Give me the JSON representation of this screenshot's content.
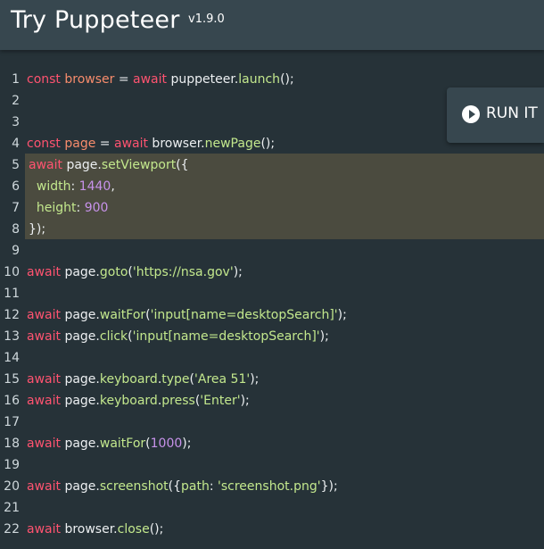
{
  "header": {
    "title": "Try Puppeteer",
    "version": "v1.9.0"
  },
  "run_button": {
    "label": "RUN IT",
    "icon": "play-circle-icon"
  },
  "colors": {
    "background": "#263238",
    "header": "#37474f",
    "keyword": "#ff5370",
    "variable": "#f78c6c",
    "function": "#c3e88d",
    "number": "#c792ea",
    "highlight": "#4b4b3f"
  },
  "editor": {
    "highlighted_lines": [
      5,
      6,
      7,
      8
    ],
    "lines": [
      {
        "n": "1",
        "tokens": [
          {
            "t": "const ",
            "c": "kw"
          },
          {
            "t": "browser",
            "c": "var"
          },
          {
            "t": " = ",
            "c": "plain"
          },
          {
            "t": "await",
            "c": "kw"
          },
          {
            "t": " puppeteer.",
            "c": "plain"
          },
          {
            "t": "launch",
            "c": "fn"
          },
          {
            "t": "();",
            "c": "plain"
          }
        ]
      },
      {
        "n": "2",
        "tokens": []
      },
      {
        "n": "3",
        "tokens": []
      },
      {
        "n": "4",
        "tokens": [
          {
            "t": "const ",
            "c": "kw"
          },
          {
            "t": "page",
            "c": "var"
          },
          {
            "t": " = ",
            "c": "plain"
          },
          {
            "t": "await",
            "c": "kw"
          },
          {
            "t": " browser.",
            "c": "plain"
          },
          {
            "t": "newPage",
            "c": "fn"
          },
          {
            "t": "();",
            "c": "plain"
          }
        ]
      },
      {
        "n": "5",
        "tokens": [
          {
            "t": "await",
            "c": "kw"
          },
          {
            "t": " page.",
            "c": "plain"
          },
          {
            "t": "setViewport",
            "c": "fn"
          },
          {
            "t": "({",
            "c": "plain"
          }
        ]
      },
      {
        "n": "6",
        "tokens": [
          {
            "t": "  ",
            "c": "plain"
          },
          {
            "t": "width",
            "c": "prop"
          },
          {
            "t": ": ",
            "c": "plain"
          },
          {
            "t": "1440",
            "c": "num"
          },
          {
            "t": ",",
            "c": "plain"
          }
        ]
      },
      {
        "n": "7",
        "tokens": [
          {
            "t": "  ",
            "c": "plain"
          },
          {
            "t": "height",
            "c": "prop"
          },
          {
            "t": ": ",
            "c": "plain"
          },
          {
            "t": "900",
            "c": "num"
          }
        ]
      },
      {
        "n": "8",
        "tokens": [
          {
            "t": "});",
            "c": "plain"
          }
        ]
      },
      {
        "n": "9",
        "tokens": []
      },
      {
        "n": "10",
        "tokens": [
          {
            "t": "await",
            "c": "kw"
          },
          {
            "t": " page.",
            "c": "plain"
          },
          {
            "t": "goto",
            "c": "fn"
          },
          {
            "t": "(",
            "c": "plain"
          },
          {
            "t": "'https://nsa.gov'",
            "c": "str"
          },
          {
            "t": ");",
            "c": "plain"
          }
        ]
      },
      {
        "n": "11",
        "tokens": []
      },
      {
        "n": "12",
        "tokens": [
          {
            "t": "await",
            "c": "kw"
          },
          {
            "t": " page.",
            "c": "plain"
          },
          {
            "t": "waitFor",
            "c": "fn"
          },
          {
            "t": "(",
            "c": "plain"
          },
          {
            "t": "'input[name=desktopSearch]'",
            "c": "str"
          },
          {
            "t": ");",
            "c": "plain"
          }
        ]
      },
      {
        "n": "13",
        "tokens": [
          {
            "t": "await",
            "c": "kw"
          },
          {
            "t": " page.",
            "c": "plain"
          },
          {
            "t": "click",
            "c": "fn"
          },
          {
            "t": "(",
            "c": "plain"
          },
          {
            "t": "'input[name=desktopSearch]'",
            "c": "str"
          },
          {
            "t": ");",
            "c": "plain"
          }
        ]
      },
      {
        "n": "14",
        "tokens": []
      },
      {
        "n": "15",
        "tokens": [
          {
            "t": "await",
            "c": "kw"
          },
          {
            "t": " page.",
            "c": "plain"
          },
          {
            "t": "keyboard",
            "c": "fn"
          },
          {
            "t": ".",
            "c": "plain"
          },
          {
            "t": "type",
            "c": "fn"
          },
          {
            "t": "(",
            "c": "plain"
          },
          {
            "t": "'Area 51'",
            "c": "str"
          },
          {
            "t": ");",
            "c": "plain"
          }
        ]
      },
      {
        "n": "16",
        "tokens": [
          {
            "t": "await",
            "c": "kw"
          },
          {
            "t": " page.",
            "c": "plain"
          },
          {
            "t": "keyboard",
            "c": "fn"
          },
          {
            "t": ".",
            "c": "plain"
          },
          {
            "t": "press",
            "c": "fn"
          },
          {
            "t": "(",
            "c": "plain"
          },
          {
            "t": "'Enter'",
            "c": "str"
          },
          {
            "t": ");",
            "c": "plain"
          }
        ]
      },
      {
        "n": "17",
        "tokens": []
      },
      {
        "n": "18",
        "tokens": [
          {
            "t": "await",
            "c": "kw"
          },
          {
            "t": " page.",
            "c": "plain"
          },
          {
            "t": "waitFor",
            "c": "fn"
          },
          {
            "t": "(",
            "c": "plain"
          },
          {
            "t": "1000",
            "c": "num"
          },
          {
            "t": ");",
            "c": "plain"
          }
        ]
      },
      {
        "n": "19",
        "tokens": []
      },
      {
        "n": "20",
        "tokens": [
          {
            "t": "await",
            "c": "kw"
          },
          {
            "t": " page.",
            "c": "plain"
          },
          {
            "t": "screenshot",
            "c": "fn"
          },
          {
            "t": "({",
            "c": "plain"
          },
          {
            "t": "path",
            "c": "prop"
          },
          {
            "t": ": ",
            "c": "plain"
          },
          {
            "t": "'screenshot.png'",
            "c": "str"
          },
          {
            "t": "});",
            "c": "plain"
          }
        ]
      },
      {
        "n": "21",
        "tokens": []
      },
      {
        "n": "22",
        "tokens": [
          {
            "t": "await",
            "c": "kw"
          },
          {
            "t": " browser.",
            "c": "plain"
          },
          {
            "t": "close",
            "c": "fn"
          },
          {
            "t": "();",
            "c": "plain"
          }
        ]
      }
    ]
  }
}
